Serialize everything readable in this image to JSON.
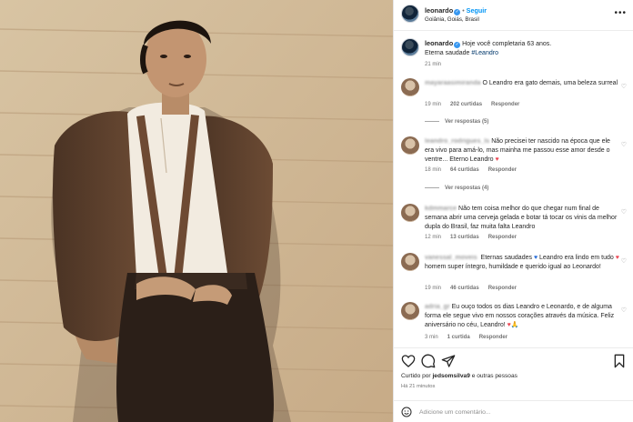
{
  "post": {
    "header": {
      "username": "leonardo",
      "separator": "•",
      "follow_label": "Seguir",
      "location": "Goiânia, Goiás, Brasil",
      "more_label": "•••"
    },
    "caption": {
      "username": "leonardo",
      "text": "Hoje você completaria 63 anos.",
      "text2": "Eterna saudade ",
      "hashtag": "#Leandro",
      "time": "21 min"
    },
    "comments": [
      {
        "username": "mayaraasimiranda",
        "text": "O Leandro era gato demais, uma beleza surreal",
        "time": "19 min",
        "likes": "202 curtidas",
        "reply_label": "Responder",
        "view_replies": "Ver respostas (5)"
      },
      {
        "username": "leandro_rodrigues_ls",
        "text": "Não precisei ter nascido na época que ele era vivo para amá-lo, mas mainha me passou esse amor desde o ventre... Eterno Leandro ",
        "heart": "♥",
        "time": "18 min",
        "likes": "64 curtidas",
        "reply_label": "Responder",
        "view_replies": "Ver respostas (4)"
      },
      {
        "username": "kdmmarce",
        "text": "Não tem coisa melhor do que chegar num final de semana abrir uma cerveja gelada e botar tá tocar os vinis da melhor dupla do Brasil, faz muita falta Leandro",
        "time": "12 min",
        "likes": "13 curtidas",
        "reply_label": "Responder"
      },
      {
        "username": "vanessal_moveis",
        "visible_suffix": "_moveis",
        "text_a": " Eternas saudades ",
        "heart_blue": "♥",
        "text_b": " Leandro era lindo em tudo ",
        "heart_red": "♥",
        "text_c": " homem super íntegro, humildade e querido igual ao Leonardo!",
        "time": "19 min",
        "likes": "46 curtidas",
        "reply_label": "Responder"
      },
      {
        "username": "adria_gr",
        "text": "Eu ouço todos os dias Leandro e Leonardo, e de alguma forma ele segue vivo em nossos corações através da música. Feliz aniversário no céu, Leandro! ",
        "heart": "♥",
        "tail": "🙏",
        "time": "3 min",
        "likes": "1 curtida",
        "reply_label": "Responder"
      }
    ],
    "likes_line": {
      "prefix": "Curtido por ",
      "user": "jedsomsilva9",
      "suffix": " e outras pessoas"
    },
    "posted_ago": "Há 21 minutos",
    "comment_placeholder": "Adicione um comentário..."
  },
  "icons": {
    "like": "heart-outline-icon",
    "comment": "speech-bubble-icon",
    "share": "paper-plane-icon",
    "save": "bookmark-icon",
    "emoji": "smiley-icon",
    "verified": "verified-badge-icon"
  },
  "colors": {
    "accent": "#0095f6",
    "verified": "#3797f0",
    "heart_red": "#ed4956",
    "hashtag": "#00376b",
    "muted": "#737373"
  }
}
